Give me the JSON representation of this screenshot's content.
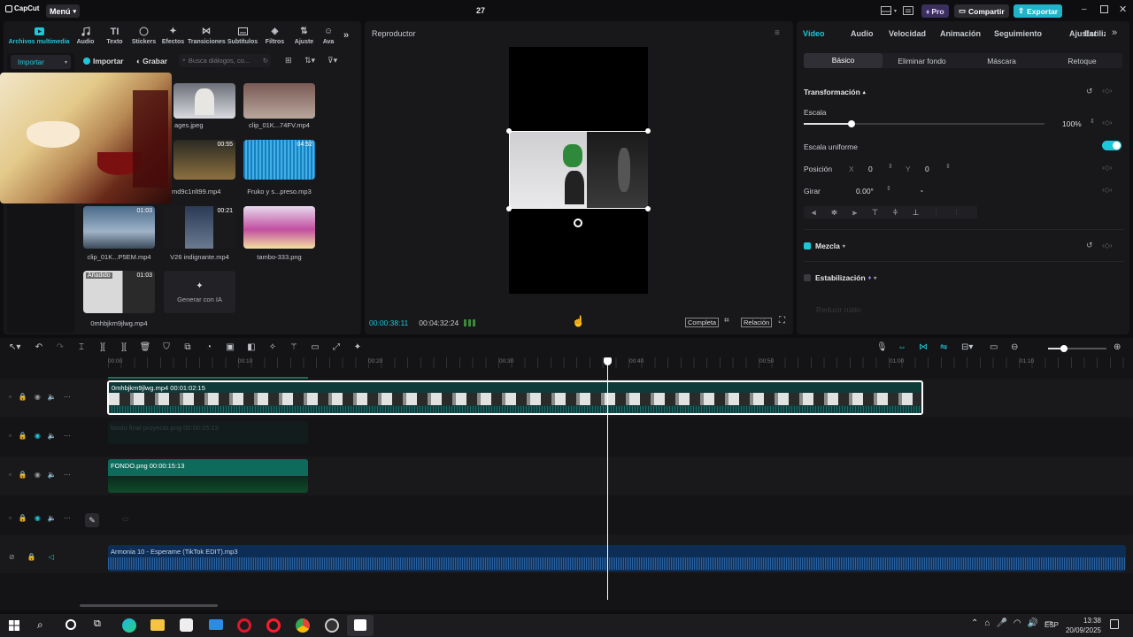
{
  "app": {
    "logo": "CapCut",
    "menu_label": "Menú",
    "title": "27",
    "pro_label": "Pro",
    "share_label": "Compartir",
    "export_label": "Exportar",
    "accent": "#1ec7d8"
  },
  "media": {
    "tools": [
      "Archivos multimedia",
      "Audio",
      "Texto",
      "Stickers",
      "Efectos",
      "Transiciones",
      "Subtítulos",
      "Filtros",
      "Ajuste",
      "Ava"
    ],
    "import_dropdown": "Importar",
    "import_button": "Importar",
    "record_button": "Grabar",
    "search_placeholder": "Busca diálogos, co...",
    "items": [
      {
        "label": "ages.jpeg"
      },
      {
        "label": "clip_01K...74FV.mp4"
      },
      {
        "label": "md9c1nlt99.mp4",
        "duration": "00:55"
      },
      {
        "label": "Fruko y s...preso.mp3",
        "duration": "04:52"
      },
      {
        "label": "clip_01K...P5EM.mp4",
        "duration": "01:03"
      },
      {
        "label": "V26 indignante.mp4",
        "duration": "00:21"
      },
      {
        "label": "tambo-333.png"
      },
      {
        "label": "0mhbjkm9jlwg.mp4",
        "duration": "01:03",
        "badge": "Añadido"
      },
      {
        "label": "Generar con IA"
      }
    ]
  },
  "player": {
    "title": "Reproductor",
    "current_time": "00:00:38:11",
    "total_time": "00:04:32:24",
    "full_label": "Completa",
    "ratio_label": "Relación"
  },
  "props": {
    "tabs": [
      "Vídeo",
      "Audio",
      "Velocidad",
      "Animación",
      "Seguimiento",
      "Ajustar",
      "Estiliz"
    ],
    "subtabs": [
      "Básico",
      "Eliminar fondo",
      "Máscara",
      "Retoque"
    ],
    "transform_label": "Transformación",
    "scale_label": "Escala",
    "scale_value": "100%",
    "scale_fraction": 0.1,
    "uniform_label": "Escala uniforme",
    "position_label": "Posición",
    "x_label": "X",
    "x_value": "0",
    "y_label": "Y",
    "y_value": "0",
    "rotate_label": "Girar",
    "rotate_value": "0.00°",
    "rotate_dash": "-",
    "blend_label": "Mezcla",
    "stabilize_label": "Estabilización",
    "faded_label": "Reducir ruido"
  },
  "timeline": {
    "ruler": [
      "00:00",
      "00:10",
      "00:20",
      "00:30",
      "00:40",
      "00:50",
      "01:00",
      "01:10"
    ],
    "clips": {
      "main": "0mhbjkm9jlwg.mp4  00:01:02:15",
      "faded": "fondo final proyecto.png  00:00:15:13",
      "fondo": "FONDO.png  00:00:15:13",
      "audio": "Armonia 10 - Esperame (TikTok EDIT).mp3"
    }
  },
  "taskbar": {
    "lang": "ESP",
    "time": "13:38",
    "date": "20/09/2025"
  }
}
